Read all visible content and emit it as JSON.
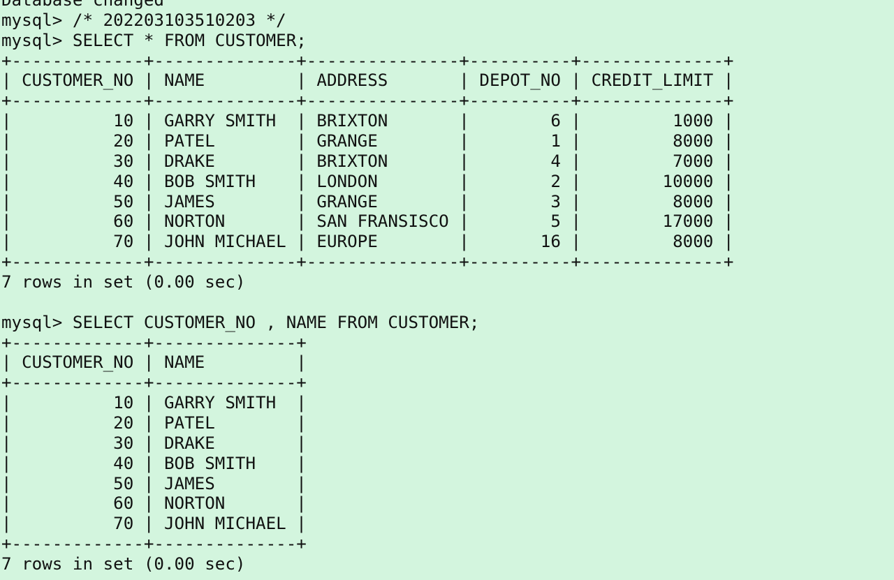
{
  "terminal": {
    "lines": [
      "Database changed",
      "mysql> /* 202203103510203 */",
      "mysql> SELECT * FROM CUSTOMER;",
      "+-------------+--------------+---------------+----------+--------------+",
      "| CUSTOMER_NO | NAME         | ADDRESS       | DEPOT_NO | CREDIT_LIMIT |",
      "+-------------+--------------+---------------+----------+--------------+",
      "|          10 | GARRY SMITH  | BRIXTON       |        6 |         1000 |",
      "|          20 | PATEL        | GRANGE        |        1 |         8000 |",
      "|          30 | DRAKE        | BRIXTON       |        4 |         7000 |",
      "|          40 | BOB SMITH    | LONDON        |        2 |        10000 |",
      "|          50 | JAMES        | GRANGE        |        3 |         8000 |",
      "|          60 | NORTON       | SAN FRANSISCO |        5 |        17000 |",
      "|          70 | JOHN MICHAEL | EUROPE        |       16 |         8000 |",
      "+-------------+--------------+---------------+----------+--------------+",
      "7 rows in set (0.00 sec)",
      "",
      "mysql> SELECT CUSTOMER_NO , NAME FROM CUSTOMER;",
      "+-------------+--------------+",
      "| CUSTOMER_NO | NAME         |",
      "+-------------+--------------+",
      "|          10 | GARRY SMITH  |",
      "|          20 | PATEL        |",
      "|          30 | DRAKE        |",
      "|          40 | BOB SMITH    |",
      "|          50 | JAMES        |",
      "|          60 | NORTON       |",
      "|          70 | JOHN MICHAEL |",
      "+-------------+--------------+",
      "7 rows in set (0.00 sec)"
    ]
  }
}
